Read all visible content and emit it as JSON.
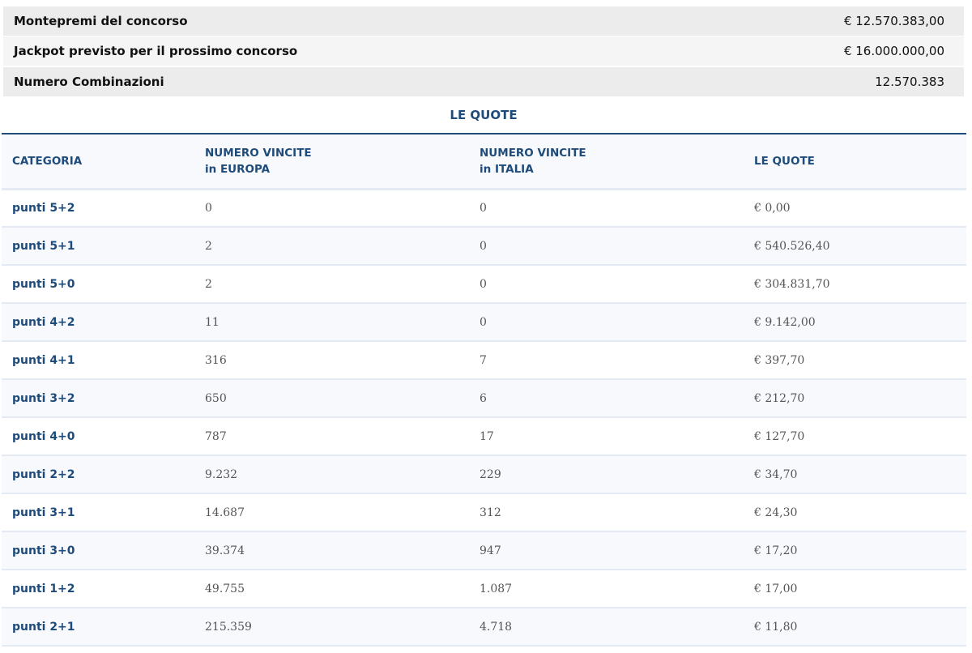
{
  "summary": [
    {
      "label": "Montepremi del concorso",
      "value": "€ 12.570.383,00"
    },
    {
      "label": "Jackpot previsto per il prossimo concorso",
      "value": "€ 16.000.000,00"
    },
    {
      "label": "Numero Combinazioni",
      "value": "12.570.383"
    }
  ],
  "quote_title": "LE QUOTE",
  "headers": {
    "cat": "CATEGORIA",
    "eu1": "NUMERO VINCITE",
    "eu2": "in EUROPA",
    "it1": "NUMERO VINCITE",
    "it2": "in ITALIA",
    "quote": "LE QUOTE"
  },
  "rows": [
    [
      "punti 5+2",
      "0",
      "0",
      "€ 0,00"
    ],
    [
      "punti 5+1",
      "2",
      "0",
      "€ 540.526,40"
    ],
    [
      "punti 5+0",
      "2",
      "0",
      "€ 304.831,70"
    ],
    [
      "punti 4+2",
      "11",
      "0",
      "€ 9.142,00"
    ],
    [
      "punti 4+1",
      "316",
      "7",
      "€ 397,70"
    ],
    [
      "punti 3+2",
      "650",
      "6",
      "€ 212,70"
    ],
    [
      "punti 4+0",
      "787",
      "17",
      "€ 127,70"
    ],
    [
      "punti 2+2",
      "9.232",
      "229",
      "€ 34,70"
    ],
    [
      "punti 3+1",
      "14.687",
      "312",
      "€ 24,30"
    ],
    [
      "punti 3+0",
      "39.374",
      "947",
      "€ 17,20"
    ],
    [
      "punti 1+2",
      "49.755",
      "1.087",
      "€ 17,00"
    ],
    [
      "punti 2+1",
      "215.359",
      "4.718",
      "€ 11,80"
    ]
  ]
}
